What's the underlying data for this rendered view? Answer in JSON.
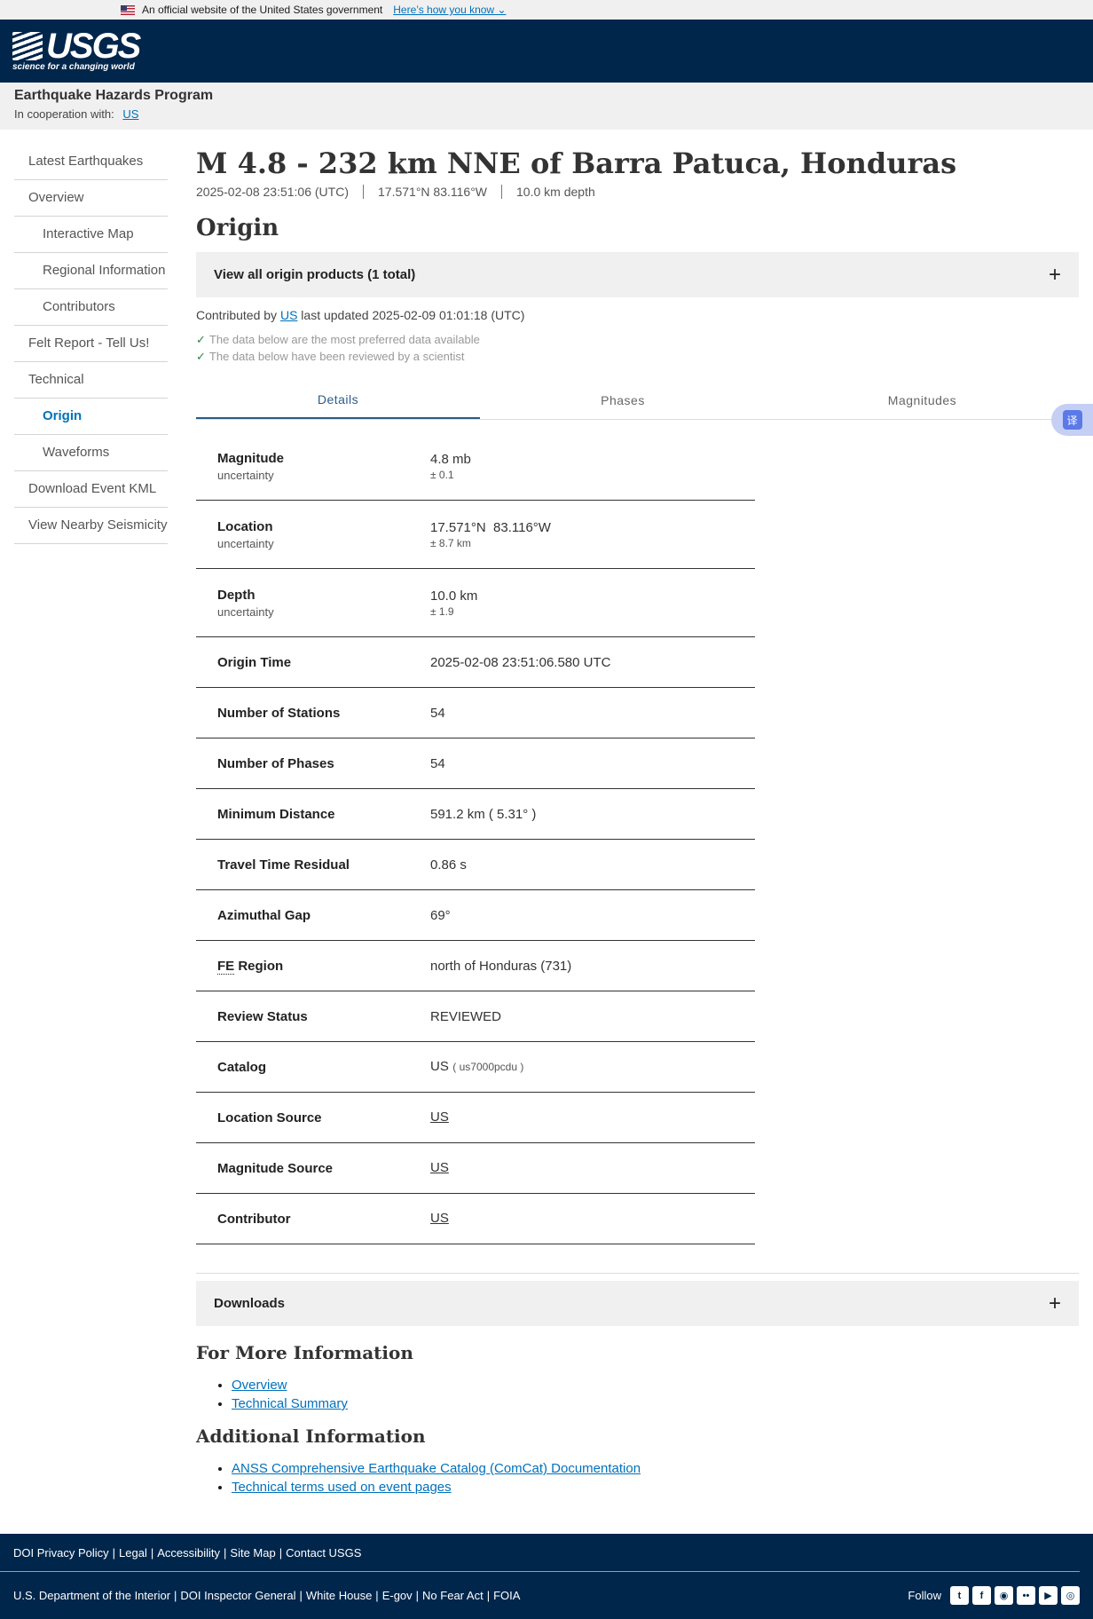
{
  "gov_banner": {
    "text": "An official website of the United States government",
    "link": "Here’s how you know"
  },
  "logo": {
    "text": "USGS",
    "tagline": "science for a changing world"
  },
  "program": {
    "title": "Earthquake Hazards Program",
    "coop_label": "In cooperation with:",
    "coop_link": "US"
  },
  "sidebar": {
    "items": [
      {
        "label": "Latest Earthquakes",
        "sub": false,
        "active": false
      },
      {
        "label": "Overview",
        "sub": false,
        "active": false
      },
      {
        "label": "Interactive Map",
        "sub": true,
        "active": false
      },
      {
        "label": "Regional Information",
        "sub": true,
        "active": false
      },
      {
        "label": "Contributors",
        "sub": true,
        "active": false
      },
      {
        "label": "Felt Report - Tell Us!",
        "sub": false,
        "active": false
      },
      {
        "label": "Technical",
        "sub": false,
        "active": false
      },
      {
        "label": "Origin",
        "sub": true,
        "active": true
      },
      {
        "label": "Waveforms",
        "sub": true,
        "active": false
      },
      {
        "label": "Download Event KML",
        "sub": false,
        "active": false
      },
      {
        "label": "View Nearby Seismicity",
        "sub": false,
        "active": false
      }
    ]
  },
  "event": {
    "title": "M 4.8 - 232 km NNE of Barra Patuca, Honduras",
    "time": "2025-02-08 23:51:06 (UTC)",
    "coords": "17.571°N 83.116°W",
    "depth": "10.0 km depth"
  },
  "origin": {
    "title": "Origin",
    "products_label": "View all origin products (1 total)",
    "contrib_prefix": "Contributed by",
    "contrib_link": "US",
    "contrib_suffix": "last updated 2025-02-09 01:01:18 (UTC)",
    "check1": "The data below are the most preferred data available",
    "check2": "The data below have been reviewed by a scientist"
  },
  "tabs": [
    "Details",
    "Phases",
    "Magnitudes"
  ],
  "details": {
    "magnitude": {
      "label": "Magnitude",
      "unc_label": "uncertainty",
      "value": "4.8 mb",
      "unc": "± 0.1"
    },
    "location": {
      "label": "Location",
      "unc_label": "uncertainty",
      "value": "17.571°N  83.116°W",
      "unc": "± 8.7 km"
    },
    "depth": {
      "label": "Depth",
      "unc_label": "uncertainty",
      "value": "10.0 km",
      "unc": "± 1.9"
    },
    "origin_time": {
      "label": "Origin Time",
      "value": "2025-02-08 23:51:06.580 UTC"
    },
    "stations": {
      "label": "Number of Stations",
      "value": "54"
    },
    "phases": {
      "label": "Number of Phases",
      "value": "54"
    },
    "min_distance": {
      "label": "Minimum Distance",
      "value": "591.2 km ( 5.31° )"
    },
    "travel_residual": {
      "label": "Travel Time Residual",
      "value": "0.86 s"
    },
    "azimuthal_gap": {
      "label": "Azimuthal Gap",
      "value": "69°"
    },
    "fe_region": {
      "label_abbr": "FE",
      "label": "Region",
      "value": "north of Honduras (731)"
    },
    "review_status": {
      "label": "Review Status",
      "value": "REVIEWED"
    },
    "catalog": {
      "label": "Catalog",
      "value": "US",
      "id": "( us7000pcdu )"
    },
    "location_source": {
      "label": "Location Source",
      "value": "US"
    },
    "magnitude_source": {
      "label": "Magnitude Source",
      "value": "US"
    },
    "contributor": {
      "label": "Contributor",
      "value": "US"
    }
  },
  "downloads": {
    "label": "Downloads"
  },
  "more_info": {
    "title": "For More Information",
    "links": [
      "Overview",
      "Technical Summary"
    ]
  },
  "additional": {
    "title": "Additional Information",
    "links": [
      "ANSS Comprehensive Earthquake Catalog (ComCat) Documentation",
      "Technical terms used on event pages"
    ]
  },
  "footer": {
    "row1": [
      "DOI Privacy Policy",
      "Legal",
      "Accessibility",
      "Site Map",
      "Contact USGS"
    ],
    "row2": [
      "U.S. Department of the Interior",
      "DOI Inspector General",
      "White House",
      "E-gov",
      "No Fear Act",
      "FOIA"
    ],
    "follow": "Follow"
  },
  "translate_label": "译"
}
